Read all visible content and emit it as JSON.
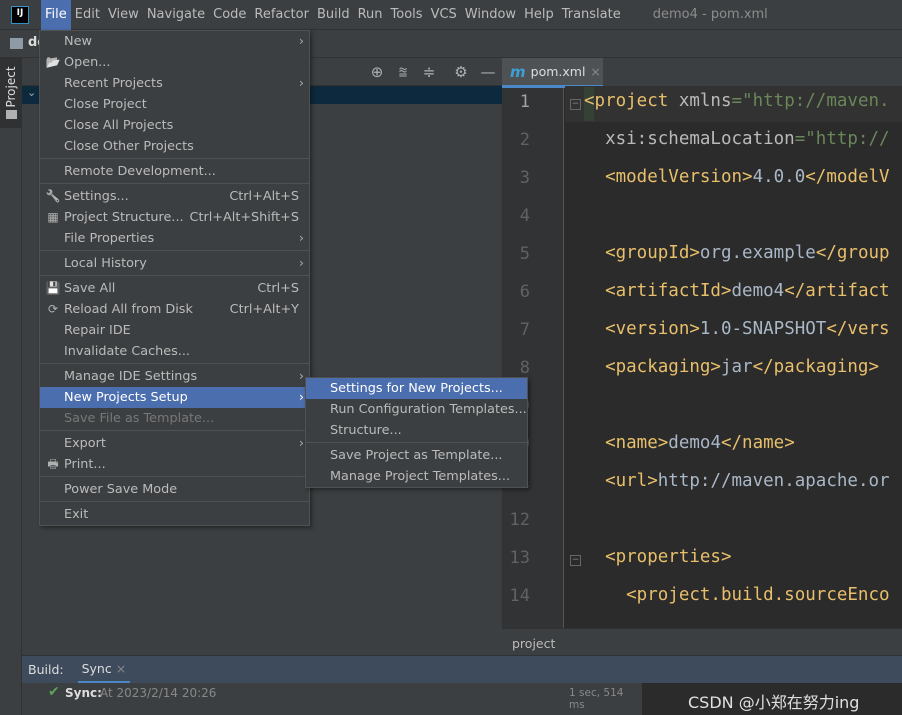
{
  "app": {
    "logo": "IJ",
    "window_title": "demo4 - pom.xml",
    "nav_project": "de"
  },
  "menubar": [
    "File",
    "Edit",
    "View",
    "Navigate",
    "Code",
    "Refactor",
    "Build",
    "Run",
    "Tools",
    "VCS",
    "Window",
    "Help",
    "Translate"
  ],
  "file_menu": [
    {
      "label": "New",
      "arrow": true
    },
    {
      "label": "Open...",
      "icon": "folder-open-icon"
    },
    {
      "label": "Recent Projects",
      "arrow": true
    },
    {
      "label": "Close Project"
    },
    {
      "label": "Close All Projects"
    },
    {
      "label": "Close Other Projects"
    },
    {
      "sep": true
    },
    {
      "label": "Remote Development..."
    },
    {
      "sep": true
    },
    {
      "label": "Settings...",
      "icon": "wrench-icon",
      "shortcut": "Ctrl+Alt+S"
    },
    {
      "label": "Project Structure...",
      "icon": "project-structure-icon",
      "shortcut": "Ctrl+Alt+Shift+S"
    },
    {
      "label": "File Properties",
      "arrow": true
    },
    {
      "sep": true
    },
    {
      "label": "Local History",
      "arrow": true
    },
    {
      "sep": true
    },
    {
      "label": "Save All",
      "icon": "save-icon",
      "shortcut": "Ctrl+S"
    },
    {
      "label": "Reload All from Disk",
      "icon": "reload-icon",
      "shortcut": "Ctrl+Alt+Y"
    },
    {
      "label": "Repair IDE"
    },
    {
      "label": "Invalidate Caches..."
    },
    {
      "sep": true
    },
    {
      "label": "Manage IDE Settings",
      "arrow": true
    },
    {
      "label": "New Projects Setup",
      "arrow": true,
      "highlighted": true
    },
    {
      "label": "Save File as Template...",
      "disabled": true
    },
    {
      "sep": true
    },
    {
      "label": "Export",
      "arrow": true
    },
    {
      "label": "Print...",
      "icon": "print-icon"
    },
    {
      "sep": true
    },
    {
      "label": "Power Save Mode"
    },
    {
      "sep": true
    },
    {
      "label": "Exit"
    }
  ],
  "submenu": [
    {
      "label": "Settings for New Projects...",
      "highlighted": true
    },
    {
      "label": "Run Configuration Templates..."
    },
    {
      "label": "Structure..."
    },
    {
      "sep": true
    },
    {
      "label": "Save Project as Template..."
    },
    {
      "label": "Manage Project Templates..."
    }
  ],
  "tool_window": {
    "stripe_label": "Project"
  },
  "editor": {
    "tab": {
      "icon": "m",
      "label": "pom.xml",
      "close": "×"
    },
    "lines": [
      [
        {
          "t": "<project ",
          "c": "tag"
        },
        {
          "t": "xmlns",
          "c": "attr"
        },
        {
          "t": "=\"http://maven.",
          "c": "str"
        }
      ],
      [
        {
          "t": "  xsi:schemaLocation",
          "c": "attr"
        },
        {
          "t": "=\"http://",
          "c": "str"
        }
      ],
      [
        {
          "t": "  <modelVersion>",
          "c": "tag"
        },
        {
          "t": "4.0.0",
          "c": "txt"
        },
        {
          "t": "</modelV",
          "c": "tag"
        }
      ],
      [],
      [
        {
          "t": "  <groupId>",
          "c": "tag"
        },
        {
          "t": "org.example",
          "c": "txt"
        },
        {
          "t": "</group",
          "c": "tag"
        }
      ],
      [
        {
          "t": "  <artifactId>",
          "c": "tag"
        },
        {
          "t": "demo4",
          "c": "txt"
        },
        {
          "t": "</artifact",
          "c": "tag"
        }
      ],
      [
        {
          "t": "  <version>",
          "c": "tag"
        },
        {
          "t": "1.0-SNAPSHOT",
          "c": "txt"
        },
        {
          "t": "</vers",
          "c": "tag"
        }
      ],
      [
        {
          "t": "  <packaging>",
          "c": "tag"
        },
        {
          "t": "jar",
          "c": "txt"
        },
        {
          "t": "</packaging>",
          "c": "tag"
        }
      ],
      [],
      [
        {
          "t": "  <name>",
          "c": "tag"
        },
        {
          "t": "demo4",
          "c": "txt"
        },
        {
          "t": "</name>",
          "c": "tag"
        }
      ],
      [
        {
          "t": "  <url>",
          "c": "tag"
        },
        {
          "t": "http://maven.apache.or",
          "c": "txt"
        }
      ],
      [],
      [
        {
          "t": "  <properties>",
          "c": "tag"
        }
      ],
      [
        {
          "t": "    <project.build.sourceEnco",
          "c": "tag"
        }
      ]
    ],
    "breadcrumb": "project"
  },
  "colors": {
    "tag": "#e8bf6a",
    "attr": "#bababa",
    "str": "#6a8759",
    "txt": "#a9b7c6",
    "accent": "#4b6eaf"
  },
  "build": {
    "label": "Build:",
    "tab": "Sync",
    "tab_close": "×",
    "status_title": "Sync:",
    "status_text": "At 2023/2/14 20:26",
    "duration": "1 sec, 514 ms"
  },
  "watermark": "CSDN @小郑在努力ing"
}
